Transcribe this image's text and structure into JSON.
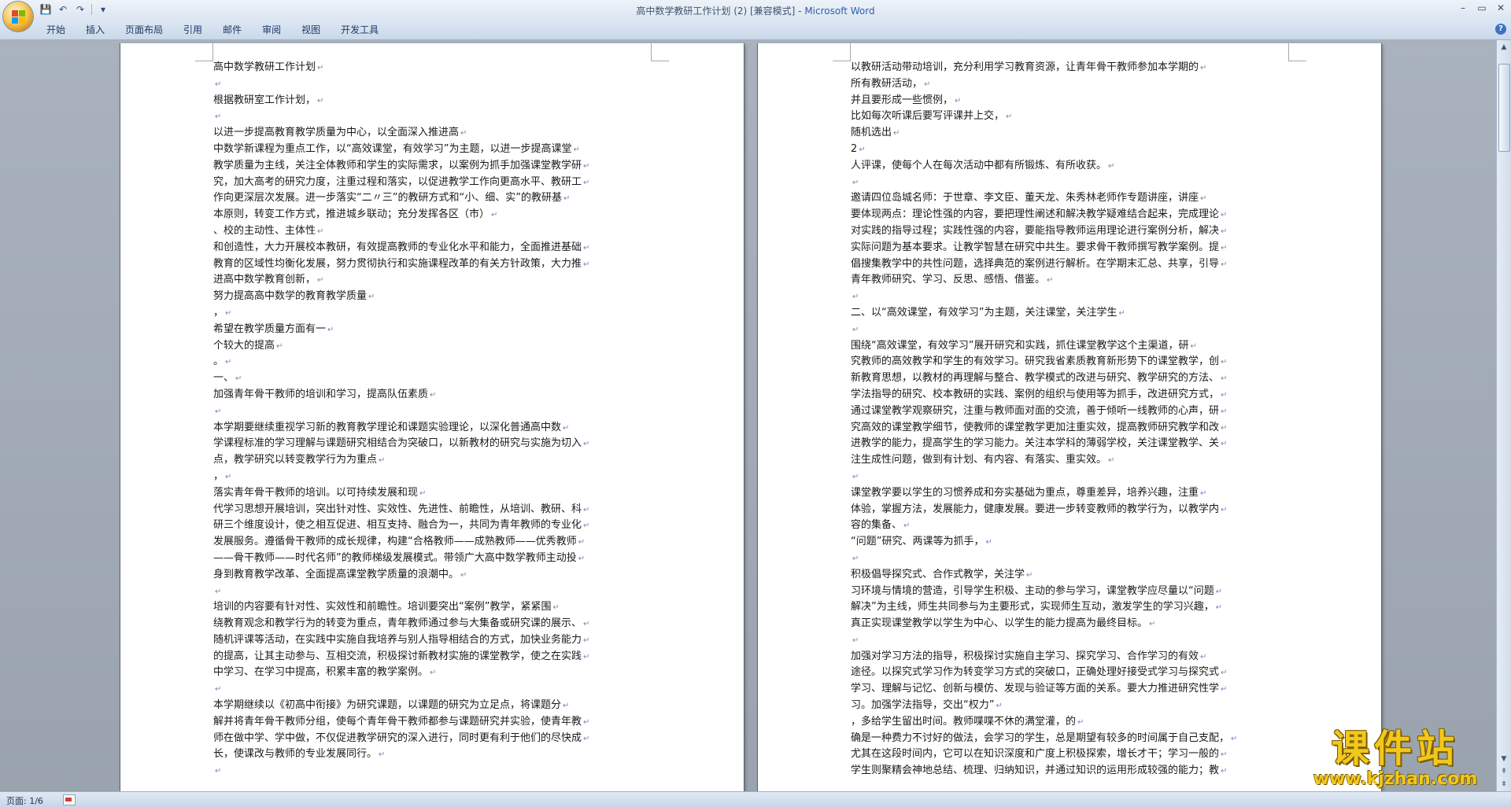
{
  "window": {
    "title_doc": "高中数学教研工作计划 (2) [兼容模式] - ",
    "title_app": "Microsoft Word",
    "minimize": "–",
    "restore": "▭",
    "close": "✕"
  },
  "qat": {
    "save": "💾",
    "undo": "↶",
    "redo": "↷",
    "more": "▾"
  },
  "tabs": [
    {
      "label": "开始"
    },
    {
      "label": "插入"
    },
    {
      "label": "页面布局"
    },
    {
      "label": "引用"
    },
    {
      "label": "邮件"
    },
    {
      "label": "审阅"
    },
    {
      "label": "视图"
    },
    {
      "label": "开发工具"
    }
  ],
  "help": "?",
  "pages": {
    "left": [
      "高中数学教研工作计划",
      "",
      "根据教研室工作计划，",
      "",
      "以进一步提高教育教学质量为中心，以全面深入推进高",
      "中数学新课程为重点工作，以“高效课堂，有效学习”为主题，以进一步提高课堂",
      "教学质量为主线，关注全体教师和学生的实际需求，以案例为抓手加强课堂教学研",
      "究，加大高考的研究力度，注重过程和落实，以促进教学工作向更高水平、教研工",
      "作向更深层次发展。进一步落实“二〃三”的教研方式和“小、细、实”的教研基",
      "本原则，转变工作方式，推进城乡联动；充分发挥各区（市）",
      "、校的主动性、主体性",
      "和创造性，大力开展校本教研，有效提高教师的专业化水平和能力，全面推进基础",
      "教育的区域性均衡化发展，努力贯彻执行和实施课程改革的有关方针政策，大力推",
      "进高中数学教育创新，",
      "努力提高高中数学的教育教学质量",
      "，",
      "希望在教学质量方面有一",
      "个较大的提高",
      "。",
      "一、",
      "加强青年骨干教师的培训和学习，提高队伍素质",
      "",
      "本学期要继续重视学习新的教育教学理论和课题实验理论，以深化普通高中数",
      "学课程标准的学习理解与课题研究相结合为突破口，以新教材的研究与实施为切入",
      "点，教学研究以转变教学行为为重点",
      "，",
      "落实青年骨干教师的培训。以可持续发展和现",
      "代学习思想开展培训，突出针对性、实效性、先进性、前瞻性，从培训、教研、科",
      "研三个维度设计，使之相互促进、相互支持、融合为一，共同为青年教师的专业化",
      "发展服务。遵循骨干教师的成长规律，构建“合格教师——成熟教师——优秀教师",
      "——骨干教师——时代名师”的教师梯级发展模式。带领广大高中数学教师主动投",
      "身到教育教学改革、全面提高课堂教学质量的浪潮中。",
      "",
      "培训的内容要有针对性、实效性和前瞻性。培训要突出“案例”教学，紧紧围",
      "绕教育观念和教学行为的转变为重点，青年教师通过参与大集备或研究课的展示、",
      "随机评课等活动，在实践中实施自我培养与别人指导相结合的方式，加快业务能力",
      "的提高，让其主动参与、互相交流，积极探讨新教材实施的课堂教学，使之在实践",
      "中学习、在学习中提高，积累丰富的教学案例。",
      "",
      "本学期继续以《初高中衔接》为研究课题，以课题的研究为立足点，将课题分",
      "解并将青年骨干教师分组，使每个青年骨干教师都参与课题研究并实验，使青年教",
      "师在做中学、学中做，不仅促进教学研究的深入进行，同时更有利于他们的尽快成",
      "长，使课改与教师的专业发展同行。",
      ""
    ],
    "right": [
      "以教研活动带动培训，充分利用学习教育资源，让青年骨干教师参加本学期的",
      "所有教研活动，",
      "并且要形成一些惯例，",
      "比如每次听课后要写评课并上交，",
      "随机选出",
      "2",
      "人评课，使每个人在每次活动中都有所锻炼、有所收获。",
      "",
      "邀请四位岛城名师：于世章、李文臣、董天龙、朱秀林老师作专题讲座，讲座",
      "要体现两点：理论性强的内容，要把理性阐述和解决教学疑难结合起来，完成理论",
      "对实践的指导过程；实践性强的内容，要能指导教师运用理论进行案例分析，解决",
      "实际问题为基本要求。让教学智慧在研究中共生。要求骨干教师撰写教学案例。提",
      "倡搜集教学中的共性问题，选择典范的案例进行解析。在学期末汇总、共享，引导",
      "青年教师研究、学习、反思、感悟、借鉴。",
      "",
      "二、以“高效课堂，有效学习”为主题，关注课堂，关注学生",
      "",
      "围绕“高效课堂，有效学习”展开研究和实践，抓住课堂教学这个主渠道，研",
      "究教师的高效教学和学生的有效学习。研究我省素质教育新形势下的课堂教学，创",
      "新教育思想，以教材的再理解与整合、教学模式的改进与研究、教学研究的方法、",
      "学法指导的研究、校本教研的实践、案例的组织与使用等为抓手，改进研究方式，",
      "通过课堂教学观察研究，注重与教师面对面的交流，善于倾听一线教师的心声，研",
      "究高效的课堂教学细节，使教师的课堂教学更加注重实效，提高教师研究教学和改",
      "进教学的能力，提高学生的学习能力。关注本学科的薄弱学校，关注课堂教学、关",
      "注生成性问题，做到有计划、有内容、有落实、重实效。",
      "",
      "课堂教学要以学生的习惯养成和夯实基础为重点，尊重差异，培养兴趣，注重",
      "体验，掌握方法，发展能力，健康发展。要进一步转变教师的教学行为，以教学内",
      "容的集备、",
      "“问题”研究、两课等为抓手，",
      "",
      "积极倡导探究式、合作式教学，关注学",
      "习环境与情境的营造，引导学生积极、主动的参与学习，课堂教学应尽量以“问题",
      "解决”为主线，师生共同参与为主要形式，实现师生互动，激发学生的学习兴趣，",
      "真正实现课堂教学以学生为中心、以学生的能力提高为最终目标。",
      "",
      "加强对学习方法的指导，积极探讨实施自主学习、探究学习、合作学习的有效",
      "途径。以探究式学习作为转变学习方式的突破口，正确处理好接受式学习与探究式",
      "学习、理解与记忆、创新与模仿、发现与验证等方面的关系。要大力推进研究性学",
      "习。加强学法指导，交出“权力”",
      "，多给学生留出时间。教师喋喋不休的满堂灌，的",
      "确是一种费力不讨好的做法，会学习的学生，总是期望有较多的时间属于自己支配，",
      "尤其在这段时间内，它可以在知识深度和广度上积极探索，增长才干；学习一般的",
      "学生则聚精会神地总结、梳理、归纳知识，并通过知识的运用形成较强的能力；教"
    ]
  },
  "status": {
    "page": "页面: 1/6"
  },
  "watermark": {
    "cn": "课件站",
    "url": "www.kjzhan.com"
  },
  "colors": {
    "accent": "#2e5fa8",
    "watermark": "#f2c81b"
  }
}
